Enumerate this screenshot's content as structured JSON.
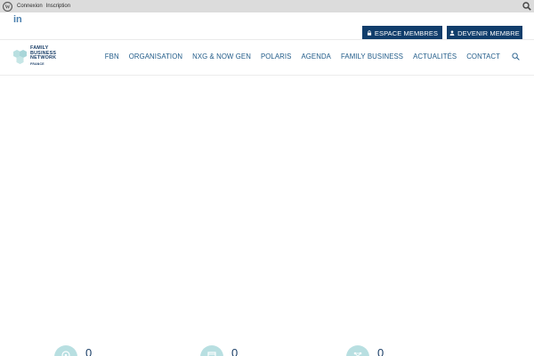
{
  "adminbar": {
    "icon": "wordpress-icon",
    "links": [
      "Connexion",
      "Inscription"
    ],
    "search_icon": "search-icon"
  },
  "topstrip": {
    "social_icon": "linkedin-icon",
    "social_text": "in",
    "buttons": [
      {
        "label": "ESPACE MEMBRES",
        "icon": "lock-icon"
      },
      {
        "label": "DEVENIR MEMBRE",
        "icon": "user-icon"
      }
    ]
  },
  "header": {
    "logo": {
      "lines": [
        "FAMILY",
        "BUSINESS",
        "NETWORK"
      ],
      "sub": "FRANCE"
    },
    "nav": [
      "FBN",
      "ORGANISATION",
      "NXG & NOW GEN",
      "POLARIS",
      "AGENDA",
      "FAMILY BUSINESS",
      "ACTUALITÉS",
      "CONTACT"
    ],
    "search_icon": "search-icon"
  },
  "counters": [
    {
      "value": "0",
      "icon": "globe-icon"
    },
    {
      "value": "0",
      "icon": "briefcase-icon"
    },
    {
      "value": "0",
      "icon": "network-icon"
    }
  ],
  "colors": {
    "primary": "#103d6b",
    "nav_text": "#1f5a88",
    "accent_circle": "#b8dfe1",
    "adminbar": "#dcdcdc"
  }
}
